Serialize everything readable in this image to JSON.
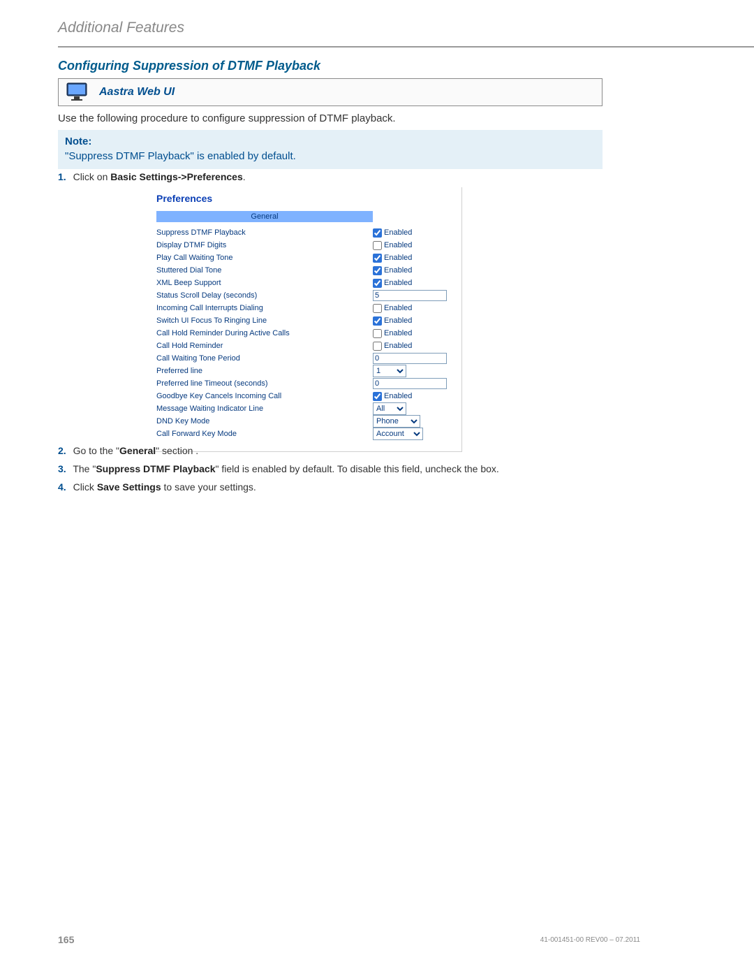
{
  "running_head": "Additional Features",
  "section_title": "Configuring Suppression of DTMF Playback",
  "callout_label": "Aastra Web UI",
  "intro_text": "Use the following procedure to configure suppression of DTMF playback.",
  "note": {
    "title": "Note:",
    "body": "\"Suppress DTMF Playback\" is enabled by default."
  },
  "steps": {
    "s1": {
      "num": "1.",
      "pre": "Click on ",
      "bold": "Basic Settings->Preferences",
      "post": "."
    },
    "s2": {
      "num": "2.",
      "pre": "Go to the \"",
      "bold": "General",
      "post": "\" section ."
    },
    "s3": {
      "num": "3.",
      "pre": "The \"",
      "bold": "Suppress DTMF Playback",
      "post": "\" field is enabled by default. To disable this field, uncheck the box."
    },
    "s4": {
      "num": "4.",
      "pre": "Click ",
      "bold": "Save Settings",
      "post": " to save your settings."
    }
  },
  "prefs": {
    "title": "Preferences",
    "general": "General",
    "enabled_label": "Enabled",
    "rows": {
      "r0": {
        "label": "Suppress DTMF Playback",
        "type": "check",
        "checked": true
      },
      "r1": {
        "label": "Display DTMF Digits",
        "type": "check",
        "checked": false
      },
      "r2": {
        "label": "Play Call Waiting Tone",
        "type": "check",
        "checked": true
      },
      "r3": {
        "label": "Stuttered Dial Tone",
        "type": "check",
        "checked": true
      },
      "r4": {
        "label": "XML Beep Support",
        "type": "check",
        "checked": true
      },
      "r5": {
        "label": "Status Scroll Delay (seconds)",
        "type": "text",
        "value": "5"
      },
      "r6": {
        "label": "Incoming Call Interrupts Dialing",
        "type": "check",
        "checked": false
      },
      "r7": {
        "label": "Switch UI Focus To Ringing Line",
        "type": "check",
        "checked": true
      },
      "r8": {
        "label": "Call Hold Reminder During Active Calls",
        "type": "check",
        "checked": false
      },
      "r9": {
        "label": "Call Hold Reminder",
        "type": "check",
        "checked": false
      },
      "r10": {
        "label": "Call Waiting Tone Period",
        "type": "text",
        "value": "0"
      },
      "r11": {
        "label": "Preferred line",
        "type": "select",
        "value": "1",
        "width": "narrow"
      },
      "r12": {
        "label": "Preferred line Timeout (seconds)",
        "type": "text",
        "value": "0"
      },
      "r13": {
        "label": "Goodbye Key Cancels Incoming Call",
        "type": "check",
        "checked": true
      },
      "r14": {
        "label": "Message Waiting Indicator Line",
        "type": "select",
        "value": "All",
        "width": "narrow"
      },
      "r15": {
        "label": "DND Key Mode",
        "type": "select",
        "value": "Phone",
        "width": "med"
      },
      "r16": {
        "label": "Call Forward Key Mode",
        "type": "select",
        "value": "Account",
        "width": "wide"
      }
    }
  },
  "footer": {
    "page": "165",
    "docid": "41-001451-00 REV00 – 07.2011"
  }
}
